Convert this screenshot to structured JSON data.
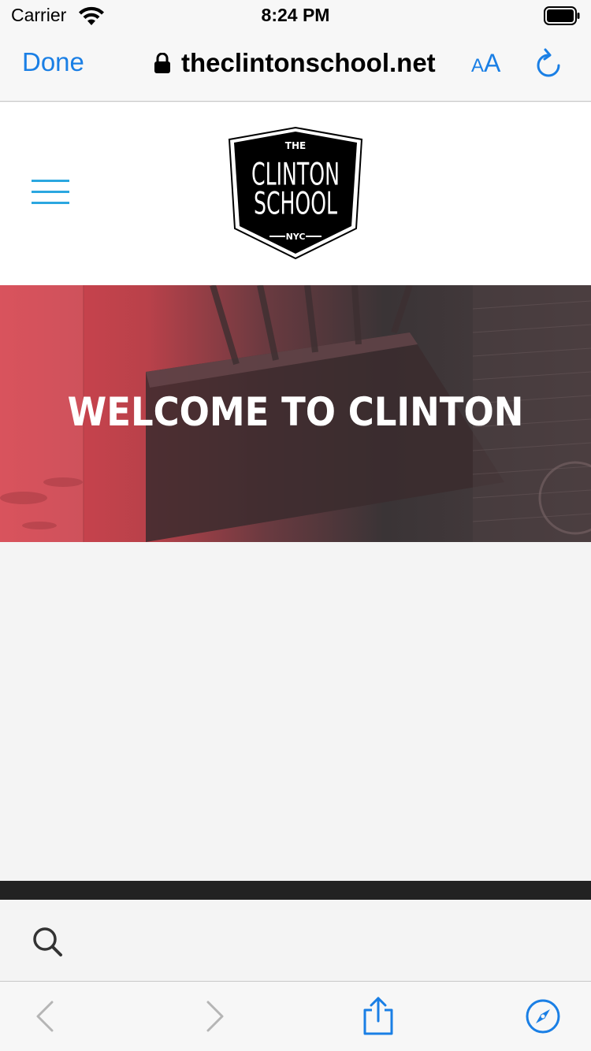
{
  "status_bar": {
    "carrier": "Carrier",
    "time": "8:24 PM",
    "icons": [
      "wifi-icon",
      "battery-icon"
    ]
  },
  "browser": {
    "done_label": "Done",
    "url": "theclintonschool.net",
    "text_size_small": "A",
    "text_size_big": "A",
    "icons": [
      "lock-icon",
      "text-size-icon",
      "reload-icon"
    ]
  },
  "site_header": {
    "menu_icon": "hamburger-menu-icon",
    "logo": {
      "top": "THE",
      "line1": "CLINTON",
      "line2": "SCHOOL",
      "bottom": "NYC"
    }
  },
  "hero": {
    "title": "WELCOME TO CLINTON"
  },
  "search": {
    "icon": "search-icon"
  },
  "toolbar": {
    "icons": [
      "back-icon",
      "forward-icon",
      "share-icon",
      "compass-icon"
    ]
  },
  "colors": {
    "accent": "#1a7fe5",
    "menu": "#2ba7e0",
    "hero_red": "#d6444f",
    "dark_strip": "#222222"
  }
}
